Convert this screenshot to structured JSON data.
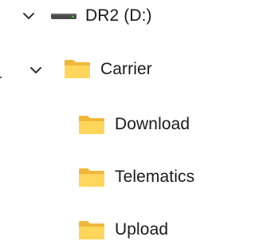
{
  "tree": {
    "drive": {
      "label": "DR2 (D:)",
      "expanded": true,
      "icon": "drive-icon"
    },
    "carrier": {
      "label": "Carrier",
      "expanded": true,
      "icon": "folder-icon"
    },
    "children": [
      {
        "label": "Download",
        "icon": "folder-icon"
      },
      {
        "label": "Telematics",
        "icon": "folder-icon"
      },
      {
        "label": "Upload",
        "icon": "folder-icon"
      }
    ]
  },
  "colors": {
    "folder_back": "#f0b83a",
    "folder_front": "#ffd65c",
    "drive_body": "#4a4a4a",
    "drive_light": "#3fbf3f",
    "chevron": "#333333"
  }
}
